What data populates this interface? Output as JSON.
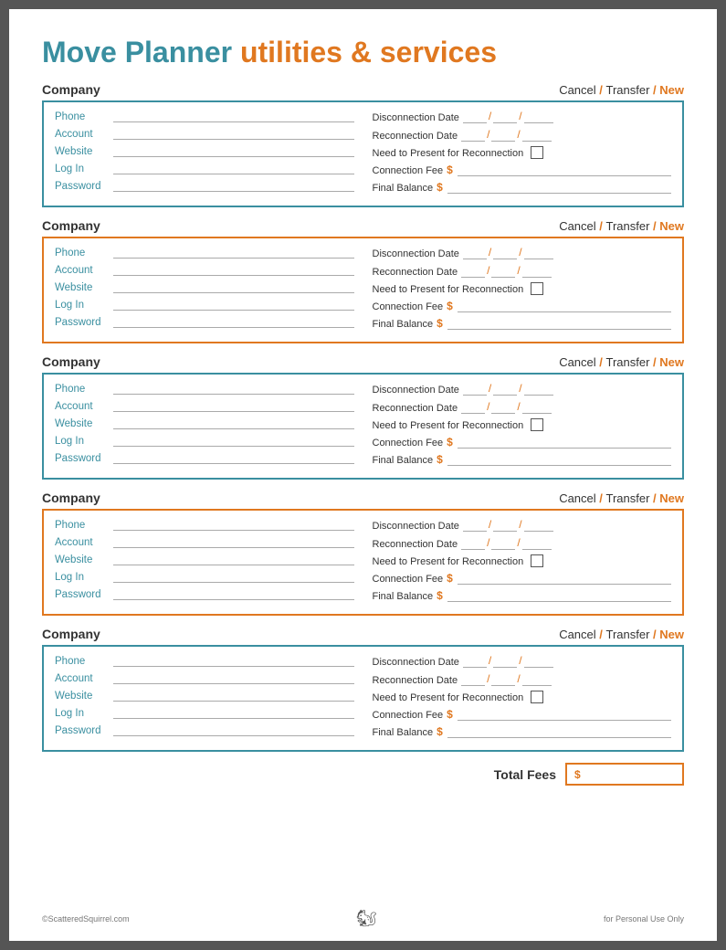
{
  "page": {
    "title_move": "Move Planner ",
    "title_rest": "utilities & services"
  },
  "sections": [
    {
      "id": 1,
      "border": "teal",
      "company_label": "Company",
      "cancel": "Cancel",
      "slash1": " / ",
      "transfer": "Transfer",
      "slash2": " / ",
      "new": "New",
      "left_fields": [
        {
          "label": "Phone",
          "value": ""
        },
        {
          "label": "Account",
          "value": ""
        },
        {
          "label": "Website",
          "value": ""
        },
        {
          "label": "Log In",
          "value": ""
        },
        {
          "label": "Password",
          "value": ""
        }
      ],
      "right_fields": [
        {
          "type": "date",
          "label": "Disconnection Date"
        },
        {
          "type": "date",
          "label": "Reconnection Date"
        },
        {
          "type": "checkbox",
          "label": "Need to Present for Reconnection"
        },
        {
          "type": "fee",
          "label": "Connection Fee"
        },
        {
          "type": "balance",
          "label": "Final Balance"
        }
      ]
    },
    {
      "id": 2,
      "border": "orange",
      "company_label": "Company",
      "cancel": "Cancel",
      "slash1": " / ",
      "transfer": "Transfer",
      "slash2": " / ",
      "new": "New",
      "left_fields": [
        {
          "label": "Phone",
          "value": ""
        },
        {
          "label": "Account",
          "value": ""
        },
        {
          "label": "Website",
          "value": ""
        },
        {
          "label": "Log In",
          "value": ""
        },
        {
          "label": "Password",
          "value": ""
        }
      ],
      "right_fields": [
        {
          "type": "date",
          "label": "Disconnection Date"
        },
        {
          "type": "date",
          "label": "Reconnection Date"
        },
        {
          "type": "checkbox",
          "label": "Need to Present for Reconnection"
        },
        {
          "type": "fee",
          "label": "Connection Fee"
        },
        {
          "type": "balance",
          "label": "Final Balance"
        }
      ]
    },
    {
      "id": 3,
      "border": "teal",
      "company_label": "Company",
      "cancel": "Cancel",
      "slash1": " / ",
      "transfer": "Transfer",
      "slash2": " / ",
      "new": "New",
      "left_fields": [
        {
          "label": "Phone",
          "value": ""
        },
        {
          "label": "Account",
          "value": ""
        },
        {
          "label": "Website",
          "value": ""
        },
        {
          "label": "Log In",
          "value": ""
        },
        {
          "label": "Password",
          "value": ""
        }
      ],
      "right_fields": [
        {
          "type": "date",
          "label": "Disconnection Date"
        },
        {
          "type": "date",
          "label": "Reconnection Date"
        },
        {
          "type": "checkbox",
          "label": "Need to Present for Reconnection"
        },
        {
          "type": "fee",
          "label": "Connection Fee"
        },
        {
          "type": "balance",
          "label": "Final Balance"
        }
      ]
    },
    {
      "id": 4,
      "border": "orange",
      "company_label": "Company",
      "cancel": "Cancel",
      "slash1": " / ",
      "transfer": "Transfer",
      "slash2": " / ",
      "new": "New",
      "left_fields": [
        {
          "label": "Phone",
          "value": ""
        },
        {
          "label": "Account",
          "value": ""
        },
        {
          "label": "Website",
          "value": ""
        },
        {
          "label": "Log In",
          "value": ""
        },
        {
          "label": "Password",
          "value": ""
        }
      ],
      "right_fields": [
        {
          "type": "date",
          "label": "Disconnection Date"
        },
        {
          "type": "date",
          "label": "Reconnection Date"
        },
        {
          "type": "checkbox",
          "label": "Need to Present for Reconnection"
        },
        {
          "type": "fee",
          "label": "Connection Fee"
        },
        {
          "type": "balance",
          "label": "Final Balance"
        }
      ]
    },
    {
      "id": 5,
      "border": "teal",
      "company_label": "Company",
      "cancel": "Cancel",
      "slash1": " / ",
      "transfer": "Transfer",
      "slash2": " / ",
      "new": "New",
      "left_fields": [
        {
          "label": "Phone",
          "value": ""
        },
        {
          "label": "Account",
          "value": ""
        },
        {
          "label": "Website",
          "value": ""
        },
        {
          "label": "Log In",
          "value": ""
        },
        {
          "label": "Password",
          "value": ""
        }
      ],
      "right_fields": [
        {
          "type": "date",
          "label": "Disconnection Date"
        },
        {
          "type": "date",
          "label": "Reconnection Date"
        },
        {
          "type": "checkbox",
          "label": "Need to Present for Reconnection"
        },
        {
          "type": "fee",
          "label": "Connection Fee"
        },
        {
          "type": "balance",
          "label": "Final Balance"
        }
      ]
    }
  ],
  "footer": {
    "left": "©ScatteredSquirrel.com",
    "right": "for Personal Use Only"
  },
  "total_fees_label": "Total Fees",
  "total_fees_symbol": "$"
}
